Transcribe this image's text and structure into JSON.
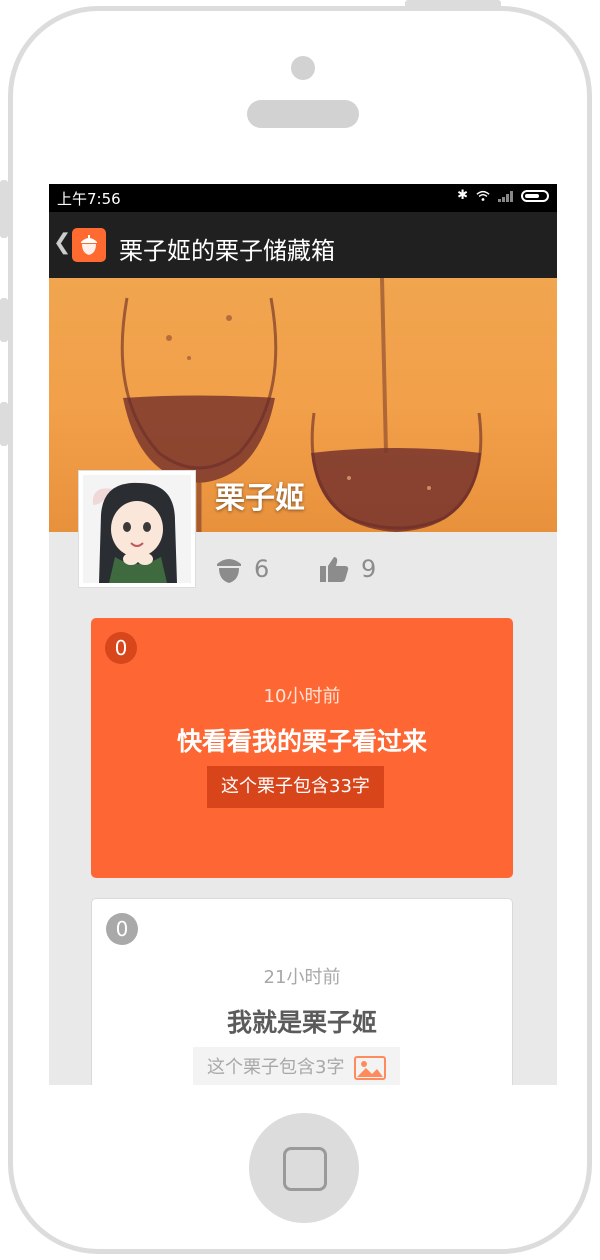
{
  "status_bar": {
    "time": "上午7:56"
  },
  "app_bar": {
    "title": "栗子姬的栗子储藏箱",
    "back_icon": "chevron-left-icon",
    "app_icon": "acorn-icon"
  },
  "profile": {
    "name": "栗子姬",
    "stats": [
      {
        "icon": "acorn-icon",
        "count": "6"
      },
      {
        "icon": "thumbs-up-icon",
        "count": "9"
      }
    ]
  },
  "cards": [
    {
      "badge": "0",
      "time": "10小时前",
      "title": "快看看我的栗子看过来",
      "count_label": "这个栗子包含33字",
      "has_image": false,
      "color": "#fe6733"
    },
    {
      "badge": "0",
      "time": "21小时前",
      "title": "我就是栗子姬",
      "count_label": "这个栗子包含3字",
      "has_image": true,
      "image_icon": "image-icon"
    }
  ],
  "colors": {
    "accent": "#fe6733",
    "appbar": "#202020",
    "statusbar": "#000000"
  }
}
